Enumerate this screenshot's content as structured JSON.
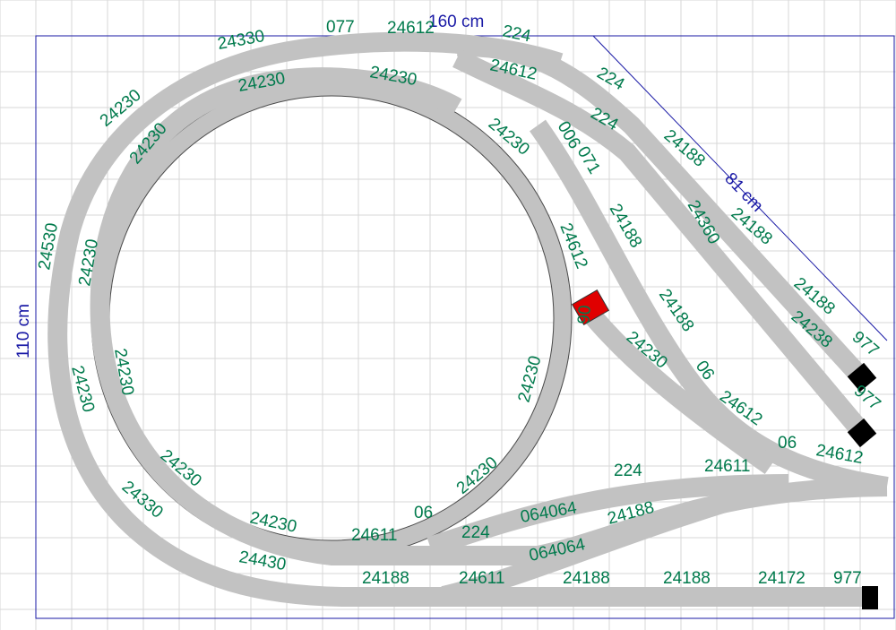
{
  "colors": {
    "track": "#c2c2c2",
    "label": "#007a4c",
    "dimension": "#1a1aa6",
    "signal": "#e00000",
    "buffer": "#000000"
  },
  "dimensions": {
    "width": "160 cm",
    "height": "110 cm",
    "diagonal": "81 cm"
  },
  "labels": [
    "24330",
    "077",
    "24612",
    "224",
    "24612",
    "224",
    "224",
    "24188",
    "24188",
    "24188",
    "977",
    "977",
    "24230",
    "24230",
    "24230",
    "24230",
    "24230",
    "24530",
    "24230",
    "24230",
    "24230",
    "24230",
    "24230",
    "24230",
    "24230",
    "24330",
    "24430",
    "24230",
    "24612",
    "06",
    "071",
    "006",
    "24188",
    "24188",
    "06",
    "24230",
    "24612",
    "06",
    "24612",
    "24360",
    "24238",
    "24611",
    "06",
    "224",
    "064064",
    "24188",
    "24188",
    "24611",
    "064064",
    "24188",
    "24188",
    "24172",
    "977",
    "24611",
    "224",
    "06",
    "24230"
  ]
}
